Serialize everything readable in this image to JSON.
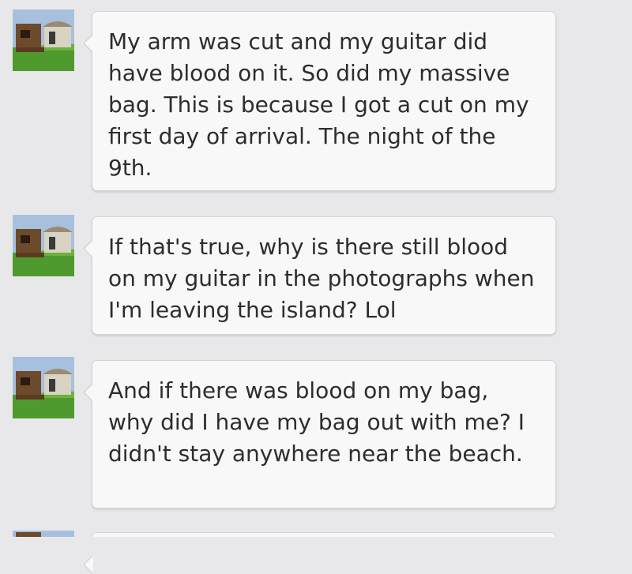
{
  "messages": [
    {
      "avatar_icon": "hut-avatar-icon",
      "text": "My arm was cut and my guitar did have blood on it. So did my massive bag. This is because I got a cut on my first day of arrival. The night of the 9th."
    },
    {
      "avatar_icon": "hut-avatar-icon",
      "text": "If that's true, why is there still blood on my guitar in the photographs when I'm leaving the island? Lol"
    },
    {
      "avatar_icon": "hut-avatar-icon",
      "text": "And if there was blood on my bag, why did I have my bag out with me? I didn't stay anywhere near the beach."
    },
    {
      "avatar_icon": "hut-avatar-icon",
      "text": ""
    }
  ]
}
